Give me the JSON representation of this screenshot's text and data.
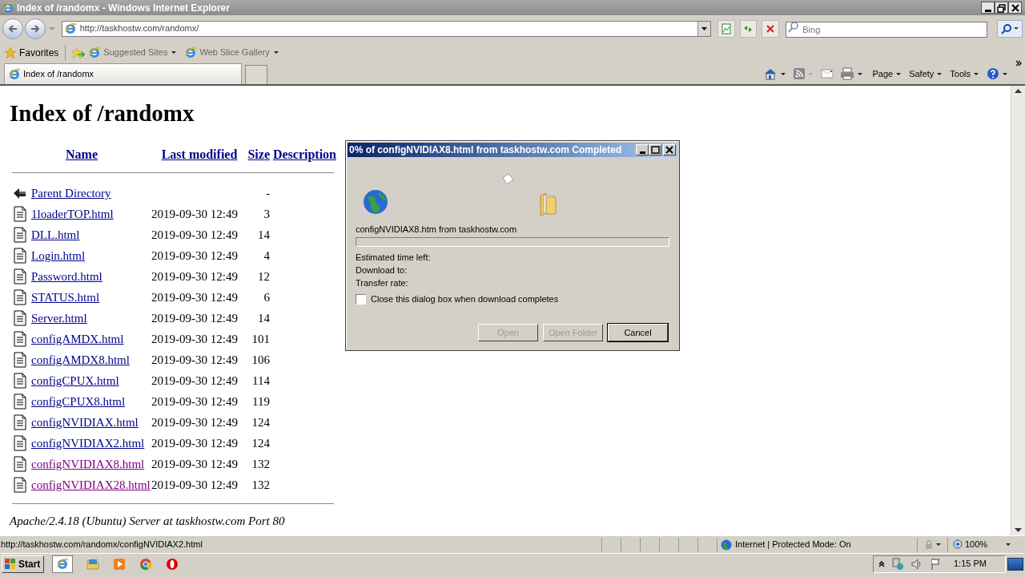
{
  "window": {
    "title": "Index of /randomx - Windows Internet Explorer"
  },
  "address_bar": {
    "url": "http://taskhostw.com/randomx/",
    "search_placeholder": "Bing"
  },
  "favorites_bar": {
    "label": "Favorites",
    "items": [
      "Suggested Sites",
      "Web Slice Gallery"
    ]
  },
  "tabs": [
    {
      "label": "Index of /randomx",
      "selected": true
    }
  ],
  "command_bar": [
    "Page",
    "Safety",
    "Tools"
  ],
  "page": {
    "heading": "Index of /randomx",
    "columns": [
      "Name",
      "Last modified",
      "Size",
      "Description"
    ],
    "rows": [
      {
        "kind": "parent",
        "name": "Parent Directory",
        "modified": "",
        "size": "-",
        "visited": false
      },
      {
        "kind": "file",
        "name": "1loaderTOP.html",
        "modified": "2019-09-30 12:49",
        "size": "3",
        "visited": false
      },
      {
        "kind": "file",
        "name": "DLL.html",
        "modified": "2019-09-30 12:49",
        "size": "14",
        "visited": false
      },
      {
        "kind": "file",
        "name": "Login.html",
        "modified": "2019-09-30 12:49",
        "size": "4",
        "visited": false
      },
      {
        "kind": "file",
        "name": "Password.html",
        "modified": "2019-09-30 12:49",
        "size": "12",
        "visited": false
      },
      {
        "kind": "file",
        "name": "STATUS.html",
        "modified": "2019-09-30 12:49",
        "size": "6",
        "visited": false
      },
      {
        "kind": "file",
        "name": "Server.html",
        "modified": "2019-09-30 12:49",
        "size": "14",
        "visited": false
      },
      {
        "kind": "file",
        "name": "configAMDX.html",
        "modified": "2019-09-30 12:49",
        "size": "101",
        "visited": false
      },
      {
        "kind": "file",
        "name": "configAMDX8.html",
        "modified": "2019-09-30 12:49",
        "size": "106",
        "visited": false
      },
      {
        "kind": "file",
        "name": "configCPUX.html",
        "modified": "2019-09-30 12:49",
        "size": "114",
        "visited": false
      },
      {
        "kind": "file",
        "name": "configCPUX8.html",
        "modified": "2019-09-30 12:49",
        "size": "119",
        "visited": false
      },
      {
        "kind": "file",
        "name": "configNVIDIAX.html",
        "modified": "2019-09-30 12:49",
        "size": "124",
        "visited": false
      },
      {
        "kind": "file",
        "name": "configNVIDIAX2.html",
        "modified": "2019-09-30 12:49",
        "size": "124",
        "visited": false
      },
      {
        "kind": "file",
        "name": "configNVIDIAX8.html",
        "modified": "2019-09-30 12:49",
        "size": "132",
        "visited": true
      },
      {
        "kind": "file",
        "name": "configNVIDIAX28.html",
        "modified": "2019-09-30 12:49",
        "size": "132",
        "visited": true
      }
    ],
    "footer": "Apache/2.4.18 (Ubuntu) Server at taskhostw.com Port 80"
  },
  "dialog": {
    "title": "0% of configNVIDIAX8.html from taskhostw.com Completed",
    "file_line": "configNVIDIAX8.htm from taskhostw.com",
    "progress": {
      "level": 0
    },
    "labels": [
      "Estimated time left:",
      "Download to:",
      "Transfer rate:"
    ],
    "checkbox": {
      "label": "Close this dialog box when download completes",
      "checked": false
    },
    "buttons": [
      {
        "label": "Open",
        "disabled": true
      },
      {
        "label": "Open Folder",
        "disabled": true
      },
      {
        "label": "Cancel",
        "disabled": false
      }
    ]
  },
  "status_bar": {
    "url": "http://taskhostw.com/randomx/configNVIDIAX2.html",
    "zone": "Internet | Protected Mode: On",
    "zoom": "100%"
  },
  "taskbar": {
    "start": "Start",
    "clock": "1:15 PM"
  }
}
